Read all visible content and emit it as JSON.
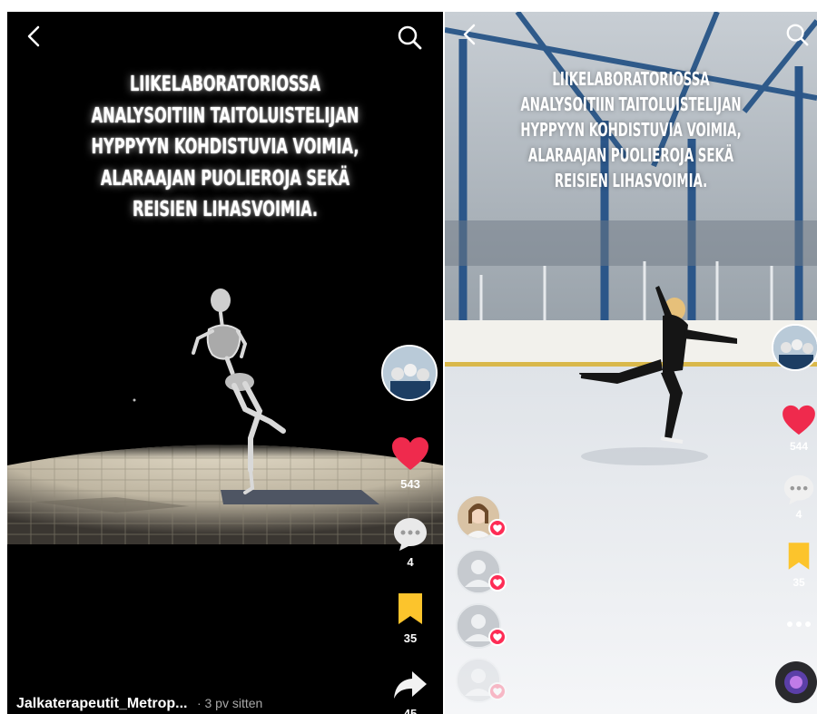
{
  "left_video": {
    "caption_lines": [
      "LIIKELABORATORIOSSA",
      "ANALYSOITIIN TAITOLUISTELIJAN",
      "HYPPYYN KOHDISTUVIA VOIMIA,",
      "ALARAAJAN PUOLIEROJA SEKÄ",
      "REISIEN LIHASVOIMIA."
    ],
    "likes": "543",
    "comments": "4",
    "saves": "35",
    "shares": "45",
    "author": "Jalkaterapeutit_Metrop...",
    "time_ago": "· 3 pv sitten"
  },
  "right_video": {
    "caption_lines": [
      "LIIKELABORATORIOSSA",
      "ANALYSOITIIN TAITOLUISTELIJAN",
      "HYPPYYN KOHDISTUVIA VOIMIA,",
      "ALARAAJAN PUOLIEROJA SEKÄ",
      "REISIEN LIHASVOIMIA."
    ],
    "likes": "544",
    "comments": "4",
    "saves": "35"
  },
  "colors": {
    "like_red": "#ef2a4d",
    "save_yellow": "#fcc42c",
    "badge_red": "#fe2c55",
    "ice_white": "#eef0f3",
    "left_background": "#000000"
  },
  "icons": {
    "back": "chevron-left-icon",
    "search": "search-icon",
    "like": "heart-icon",
    "comment": "comment-bubble-icon",
    "save": "bookmark-icon",
    "share": "share-arrow-icon",
    "more": "more-dots-icon",
    "music": "music-disc-icon"
  }
}
